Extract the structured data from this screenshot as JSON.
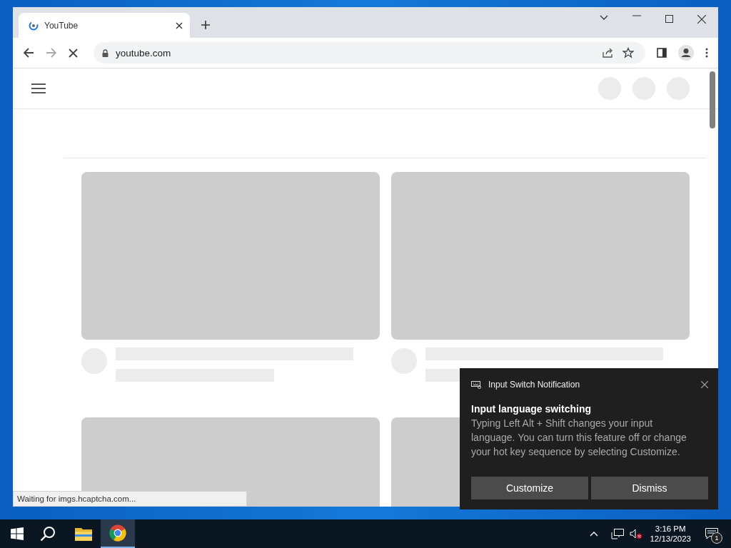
{
  "browser": {
    "tabs": [
      {
        "title": "YouTube",
        "selected": true
      }
    ],
    "address": "youtube.com",
    "loading": true,
    "status_text": "Waiting for imgs.hcaptcha.com..."
  },
  "notification": {
    "app": "Input Switch Notification",
    "title": "Input language switching",
    "body": "Typing Left Alt + Shift changes your input language. You can turn this feature off or change your hot key sequence by selecting Customize.",
    "buttons": [
      "Customize",
      "Dismiss"
    ]
  },
  "taskbar": {
    "apps": [
      {
        "kind": "explorer",
        "selected": false
      },
      {
        "kind": "chrome",
        "selected": true
      }
    ],
    "time": "3:16 PM",
    "date": "12/13/2023",
    "notification_count": "1"
  }
}
